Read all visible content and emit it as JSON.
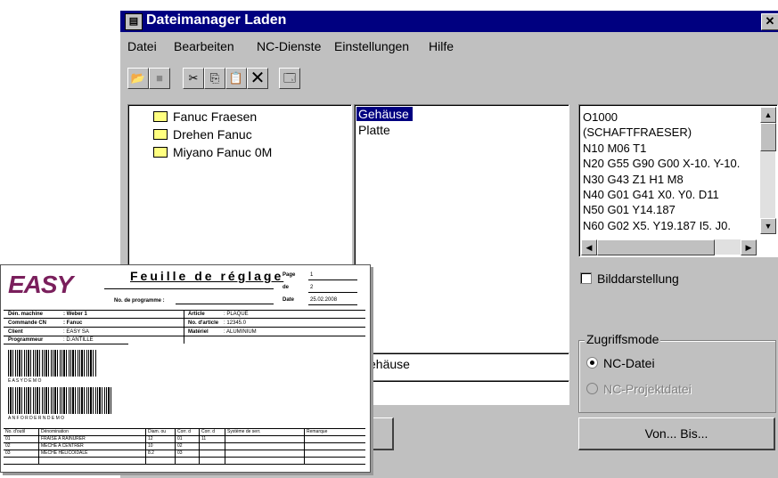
{
  "window": {
    "title": "Dateimanager Laden",
    "close_glyph": "✕"
  },
  "menu": [
    "Datei",
    "Bearbeiten",
    "NC-Dienste",
    "Einstellungen",
    "Hilfe"
  ],
  "toolbar": [
    "open-folder-icon",
    "disabled-save-icon",
    "cut-icon",
    "copy-icon",
    "paste-icon",
    "delete-icon",
    "properties-icon"
  ],
  "tree": {
    "items": [
      "Fanuc Fraesen",
      "Drehen Fanuc",
      "Miyano Fanuc 0M"
    ]
  },
  "files": {
    "items": [
      "Gehäuse",
      "Platte"
    ],
    "selected": "Gehäuse"
  },
  "preview": {
    "lines": [
      "O1000",
      "(SCHAFTFRAESER)",
      "N10 M06 T1",
      "N20 G55 G90 G00 X-10. Y-10.",
      "N30 G43 Z1 H1 M8",
      "N40 G01 G41 X0. Y0. D11",
      "N50 G01 Y14.187",
      "N60 G02 X5. Y19.187 I5. J0."
    ]
  },
  "options": {
    "bilddarstellung": "Bilddarstellung"
  },
  "filename_field": {
    "value": "ehäuse"
  },
  "access_mode": {
    "legend": "Zugriffsmode",
    "option1": "NC-Datei",
    "option2": "NC-Projektdatei"
  },
  "buttons": {
    "von_bis": "Von... Bis..."
  },
  "sheet": {
    "logo": "EASY",
    "title": "Feuille de réglage",
    "program_label": "No. de programme :",
    "page_label": "Page",
    "page_value": "1",
    "of_label": "de",
    "of_value": "2",
    "date_label": "Date",
    "date_value": "25.02.2008",
    "machine_label": "Dén. machine",
    "machine_value": ": Weber 1",
    "cn_label": "Commande CN",
    "cn_value": ": Fanuc",
    "client_label": "Client",
    "client_value": ":  EASY SA",
    "prog_label": "Programmeur",
    "prog_value": ":  D.ANTILLE",
    "article_label": "Article",
    "article_value": ":  PLAQUE",
    "article_no_label": "No. d'article",
    "article_no_value": ":  12345.0",
    "material_label": "Matériel",
    "material_value": ":  ALUMINIUM",
    "barcode1_text": "E A S Y  D E M O",
    "barcode2_text": "A N F O R D E R N  D E M O",
    "table_headers": [
      "No. d'outil",
      "Dénomination",
      "Diam. ou",
      "Corr. d",
      "Corr. d",
      "Système de serr.",
      "Remarque"
    ],
    "rows": [
      [
        "01",
        "FRAISE A RAINURER",
        "12",
        "01",
        "11",
        "",
        ""
      ],
      [
        "02",
        "MECHE A CENTRER",
        "10",
        "02",
        "",
        "",
        ""
      ],
      [
        "03",
        "MECHE HELICOIDALE",
        "8.2",
        "03",
        "",
        "",
        ""
      ]
    ]
  }
}
